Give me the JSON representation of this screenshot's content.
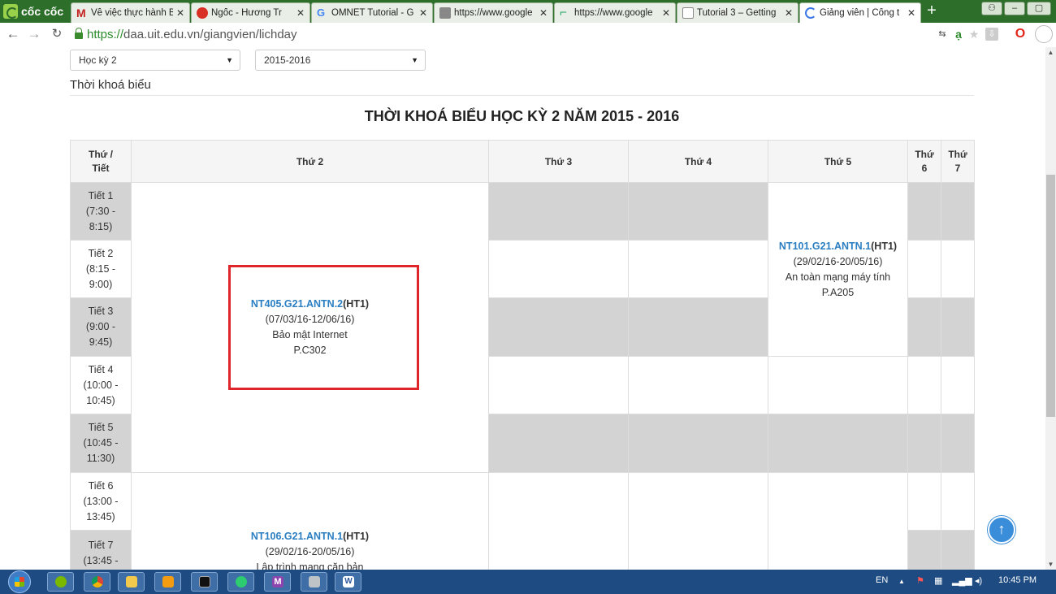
{
  "browser": {
    "brand": "cốc cốc",
    "tabs": [
      {
        "title": "Về việc thực hành B",
        "fav_color": "#c5221f",
        "active": false
      },
      {
        "title": "Ngốc - Hương Tr",
        "fav_color": "#d93025",
        "active": false
      },
      {
        "title": "OMNET Tutorial - G",
        "fav_color": "#4285f4",
        "active": false
      },
      {
        "title": "https://www.google",
        "fav_color": "#888888",
        "active": false
      },
      {
        "title": "https://www.google",
        "fav_color": "#1aa260",
        "active": false
      },
      {
        "title": "Tutorial 3 – Getting",
        "fav_color": "#aaaaaa",
        "active": false
      },
      {
        "title": "Giảng viên | Cổng t",
        "fav_color": "#3b78e7",
        "active": true
      }
    ],
    "url_scheme": "https://",
    "url_rest": "daa.uit.edu.vn/giangvien/lichday"
  },
  "filters": {
    "semester": "Học kỳ 2",
    "year": "2015-2016"
  },
  "section_label": "Thời khoá biểu",
  "timetable": {
    "title": "THỜI KHOÁ BIỂU HỌC KỲ 2 NĂM 2015 - 2016",
    "headers": [
      {
        "label": "Thứ / Tiết"
      },
      {
        "label": "Thứ 2"
      },
      {
        "label": "Thứ 3"
      },
      {
        "label": "Thứ 4"
      },
      {
        "label": "Thứ 5"
      },
      {
        "label": "Thứ 6"
      },
      {
        "label": "Thứ 7"
      }
    ],
    "periods": [
      {
        "name": "Tiết 1",
        "time": "(7:30 -",
        "time2": "8:15)"
      },
      {
        "name": "Tiết 2",
        "time": "(8:15 -",
        "time2": "9:00)"
      },
      {
        "name": "Tiết 3",
        "time": "(9:00 -",
        "time2": "9:45)"
      },
      {
        "name": "Tiết 4",
        "time": "(10:00 -",
        "time2": "10:45)"
      },
      {
        "name": "Tiết 5",
        "time": "(10:45 -",
        "time2": "11:30)"
      },
      {
        "name": "Tiết 6",
        "time": "(13:00 -",
        "time2": "13:45)"
      },
      {
        "name": "Tiết 7",
        "time": "(13:45 -",
        "time2": ""
      }
    ],
    "courses": [
      {
        "code": "NT405.G21.ANTN.2",
        "group": "(HT1)",
        "dates": "(07/03/16-12/06/16)",
        "name": "Bảo mật Internet",
        "room": "P.C302"
      },
      {
        "code": "NT101.G21.ANTN.1",
        "group": "(HT1)",
        "dates": "(29/02/16-20/05/16)",
        "name": "An toàn mạng máy tính",
        "room": "P.A205"
      },
      {
        "code": "NT106.G21.ANTN.1",
        "group": "(HT1)",
        "dates": "(29/02/16-20/05/16)",
        "name": "Lập trình mạng căn bản",
        "room": ""
      }
    ]
  },
  "taskbar": {
    "lang": "EN",
    "clock": "10:45 PM"
  },
  "colors": {
    "tabbar": "#2d6f2a",
    "link": "#2a7ec2",
    "highlight": "#e0252a",
    "disabled_cell": "#d3d3d3"
  }
}
